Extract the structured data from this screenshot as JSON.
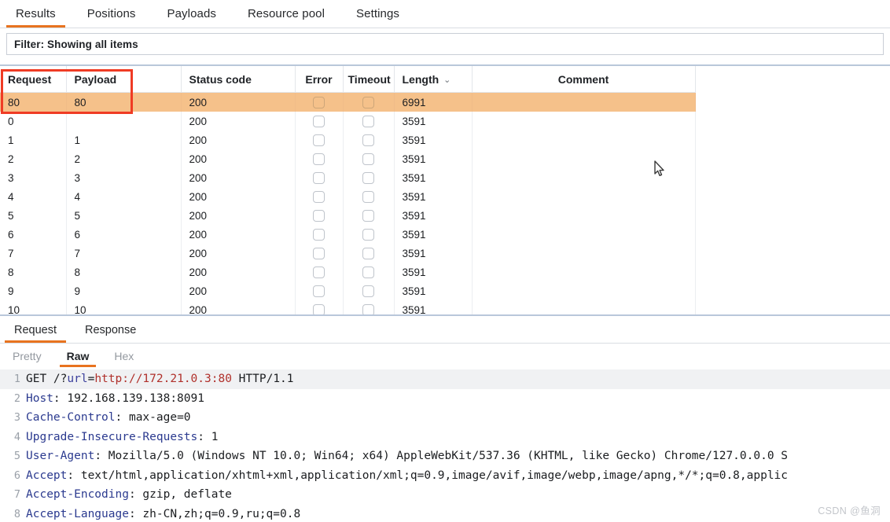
{
  "colors": {
    "accent": "#e8731f",
    "selected_row": "#f5c18a",
    "annotation": "#ef3b24",
    "panel_border": "#b9c7da"
  },
  "top_tabs": [
    {
      "label": "Results",
      "active": true
    },
    {
      "label": "Positions",
      "active": false
    },
    {
      "label": "Payloads",
      "active": false
    },
    {
      "label": "Resource pool",
      "active": false
    },
    {
      "label": "Settings",
      "active": false
    }
  ],
  "filter": {
    "text": "Filter: Showing all items"
  },
  "results_table": {
    "columns": [
      {
        "label": "Request",
        "align": "left"
      },
      {
        "label": "Payload",
        "align": "left"
      },
      {
        "label": "Status code",
        "align": "left"
      },
      {
        "label": "Error",
        "align": "center"
      },
      {
        "label": "Timeout",
        "align": "center"
      },
      {
        "label": "Length",
        "align": "left",
        "sort_icon": "chevron-down-icon"
      },
      {
        "label": "Comment",
        "align": "center"
      }
    ],
    "rows": [
      {
        "request": "80",
        "payload": "80",
        "status": "200",
        "error": false,
        "timeout": false,
        "length": "6991",
        "comment": "",
        "selected": true
      },
      {
        "request": "0",
        "payload": "",
        "status": "200",
        "error": false,
        "timeout": false,
        "length": "3591",
        "comment": "",
        "selected": false
      },
      {
        "request": "1",
        "payload": "1",
        "status": "200",
        "error": false,
        "timeout": false,
        "length": "3591",
        "comment": "",
        "selected": false
      },
      {
        "request": "2",
        "payload": "2",
        "status": "200",
        "error": false,
        "timeout": false,
        "length": "3591",
        "comment": "",
        "selected": false
      },
      {
        "request": "3",
        "payload": "3",
        "status": "200",
        "error": false,
        "timeout": false,
        "length": "3591",
        "comment": "",
        "selected": false
      },
      {
        "request": "4",
        "payload": "4",
        "status": "200",
        "error": false,
        "timeout": false,
        "length": "3591",
        "comment": "",
        "selected": false
      },
      {
        "request": "5",
        "payload": "5",
        "status": "200",
        "error": false,
        "timeout": false,
        "length": "3591",
        "comment": "",
        "selected": false
      },
      {
        "request": "6",
        "payload": "6",
        "status": "200",
        "error": false,
        "timeout": false,
        "length": "3591",
        "comment": "",
        "selected": false
      },
      {
        "request": "7",
        "payload": "7",
        "status": "200",
        "error": false,
        "timeout": false,
        "length": "3591",
        "comment": "",
        "selected": false
      },
      {
        "request": "8",
        "payload": "8",
        "status": "200",
        "error": false,
        "timeout": false,
        "length": "3591",
        "comment": "",
        "selected": false
      },
      {
        "request": "9",
        "payload": "9",
        "status": "200",
        "error": false,
        "timeout": false,
        "length": "3591",
        "comment": "",
        "selected": false
      },
      {
        "request": "10",
        "payload": "10",
        "status": "200",
        "error": false,
        "timeout": false,
        "length": "3591",
        "comment": "",
        "selected": false
      }
    ]
  },
  "message_tabs": [
    {
      "label": "Request",
      "active": true
    },
    {
      "label": "Response",
      "active": false
    }
  ],
  "view_tabs": [
    {
      "label": "Pretty",
      "active": false,
      "disabled": true
    },
    {
      "label": "Raw",
      "active": true,
      "disabled": false
    },
    {
      "label": "Hex",
      "active": false,
      "disabled": false
    }
  ],
  "request_raw": {
    "lines": [
      {
        "n": "1",
        "highlight": true,
        "tokens": [
          {
            "t": "GET /?",
            "c": "plain"
          },
          {
            "t": "url",
            "c": "key"
          },
          {
            "t": "=",
            "c": "plain"
          },
          {
            "t": "http://172.21.0.3:80",
            "c": "url"
          },
          {
            "t": " HTTP/1.1",
            "c": "plain"
          }
        ]
      },
      {
        "n": "2",
        "highlight": false,
        "tokens": [
          {
            "t": "Host",
            "c": "hdr"
          },
          {
            "t": ": 192.168.139.138:8091",
            "c": "plain"
          }
        ]
      },
      {
        "n": "3",
        "highlight": false,
        "tokens": [
          {
            "t": "Cache-Control",
            "c": "hdr"
          },
          {
            "t": ": max-age=0",
            "c": "plain"
          }
        ]
      },
      {
        "n": "4",
        "highlight": false,
        "tokens": [
          {
            "t": "Upgrade-Insecure-Requests",
            "c": "hdr"
          },
          {
            "t": ": 1",
            "c": "plain"
          }
        ]
      },
      {
        "n": "5",
        "highlight": false,
        "tokens": [
          {
            "t": "User-Agent",
            "c": "hdr"
          },
          {
            "t": ": Mozilla/5.0 (Windows NT 10.0; Win64; x64) AppleWebKit/537.36 (KHTML, like Gecko) Chrome/127.0.0.0 S",
            "c": "plain"
          }
        ]
      },
      {
        "n": "6",
        "highlight": false,
        "tokens": [
          {
            "t": "Accept",
            "c": "hdr"
          },
          {
            "t": ": text/html,application/xhtml+xml,application/xml;q=0.9,image/avif,image/webp,image/apng,*/*;q=0.8,applic",
            "c": "plain"
          }
        ]
      },
      {
        "n": "7",
        "highlight": false,
        "tokens": [
          {
            "t": "Accept-Encoding",
            "c": "hdr"
          },
          {
            "t": ": gzip, deflate",
            "c": "plain"
          }
        ]
      },
      {
        "n": "8",
        "highlight": false,
        "tokens": [
          {
            "t": "Accept-Language",
            "c": "hdr"
          },
          {
            "t": ": zh-CN,zh;q=0.9,ru;q=0.8",
            "c": "plain"
          }
        ]
      }
    ]
  },
  "watermark": {
    "text": "CSDN @鱼洞"
  }
}
